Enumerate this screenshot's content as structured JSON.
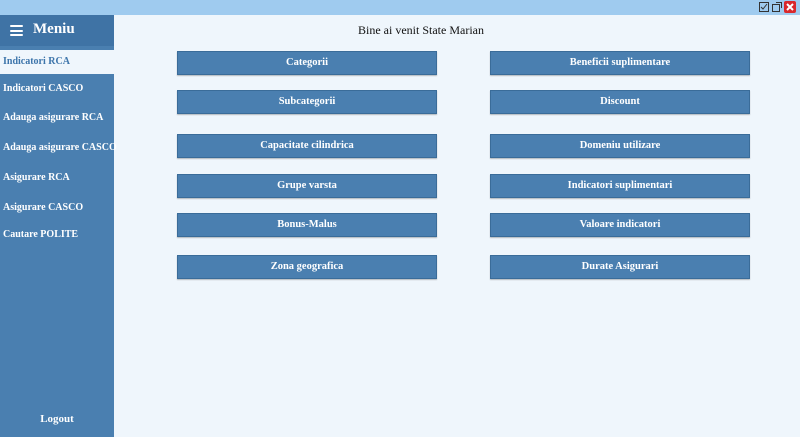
{
  "window": {
    "title_buttons": [
      "minimize-icon",
      "maximize-icon",
      "close-icon"
    ],
    "titlebar_color": "#9fcbef"
  },
  "sidebar": {
    "title": "Meniu",
    "items": [
      {
        "label": "Indicatori RCA",
        "active": true
      },
      {
        "label": "Indicatori CASCO",
        "active": false
      },
      {
        "label": "Adauga asigurare RCA",
        "active": false
      },
      {
        "label": "Adauga asigurare CASCO",
        "active": false
      },
      {
        "label": "Asigurare RCA",
        "active": false
      },
      {
        "label": "Asigurare CASCO",
        "active": false
      },
      {
        "label": "Cautare POLITE",
        "active": false
      }
    ],
    "logout_label": "Logout",
    "background_color": "#4a7fb0"
  },
  "main": {
    "welcome_text": "Bine ai venit State  Marian",
    "left_buttons": [
      "Categorii",
      "Subcategorii",
      "Capacitate cilindrica",
      "Grupe varsta",
      "Bonus-Malus",
      "Zona geografica"
    ],
    "right_buttons": [
      "Beneficii suplimentare",
      "Discount",
      "Domeniu utilizare",
      "Indicatori suplimentari",
      "Valoare indicatori",
      "Durate Asigurari"
    ],
    "button_color": "#4a7fb0",
    "background_color": "#eff6fc"
  }
}
